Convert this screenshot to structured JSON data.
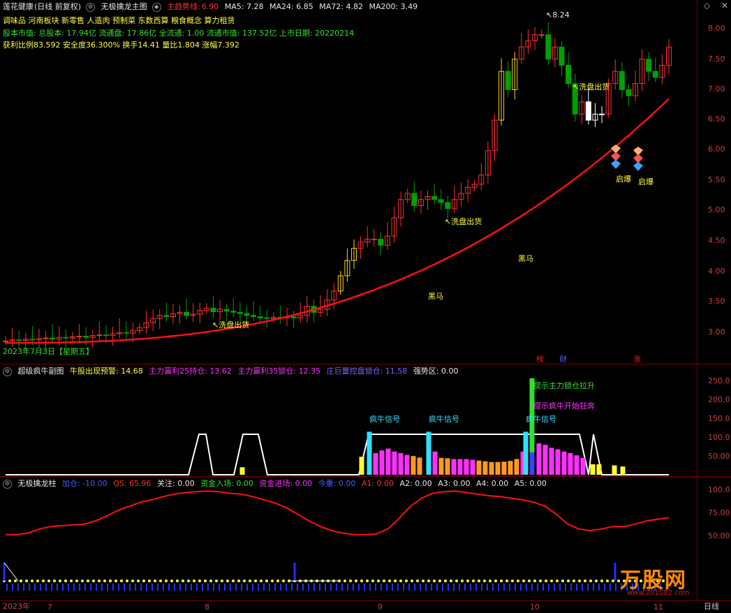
{
  "main_panel": {
    "stock_name": "莲花健康",
    "period": "(日线 前复权)",
    "indicator_name": "无极擒龙主图",
    "trend_label": "主趋势线:",
    "trend_value": "6.90",
    "ma5": "MA5: 7.28",
    "ma24": "MA24: 6.85",
    "ma72": "MA72: 4.82",
    "ma200": "MA200: 3.49",
    "concepts": "调味品 河南板块 新零售 人造肉 预制菜 东数西算 粮食概念 算力租赁",
    "info_line": "股本市值: 总股本: 17.94亿 流通盘: 17.86亿 全流通: 1.00 流通市值: 137.52亿 上市日期: 20220214",
    "stats_line": "获利比例83.592 安全度36.300% 换手14.41 量比1.804 涨幅7.392",
    "date_label": "2023年7月3日【星期五】",
    "peak_label": "8.24",
    "annotations": [
      "洗盘出货",
      "洗盘出货",
      "洗盘出货",
      "黑马",
      "黑马",
      "启爆",
      "启爆"
    ],
    "tags": [
      "榜",
      "财",
      "涨"
    ],
    "y_ticks": [
      "8.00",
      "7.50",
      "7.00",
      "6.50",
      "6.00",
      "5.50",
      "5.00",
      "4.50",
      "4.00",
      "3.50",
      "3.00"
    ]
  },
  "sub_panel": {
    "name": "超级疯牛副图",
    "warn_label": "牛股出现预警: 14.68",
    "profit25": "主力赢利25持仓: 13.62",
    "profit35": "主力赢利35锁仓: 12.35",
    "control": "庄巨量控盘锁仓: 11.58",
    "strong": "强势区: 0.00",
    "signals": [
      "疯牛信号",
      "疯牛信号",
      "疯牛信号"
    ],
    "text1": "提示主力锁仓拉升",
    "text2": "提示疯牛开始狂奔",
    "y_ticks": [
      "250.0",
      "200.0",
      "150.0",
      "100.0",
      "50.00"
    ]
  },
  "bottom_panel": {
    "name": "无极擒龙柱",
    "add": "加仓: -10.00",
    "qs": "QS: 65.96",
    "focus": "关注: 0.00",
    "enter": "资金入场: 0.00",
    "inflow": "资金进场: 0.00",
    "today": "今重: 0.00",
    "a1": "A1: 0.00",
    "a2": "A2: 0.00",
    "a3": "A3: 0.00",
    "a4": "A4: 0.00",
    "a5": "A5: 0.00",
    "y_ticks": [
      "100.0",
      "75.00",
      "50.00"
    ]
  },
  "x_axis": {
    "year": "2023年",
    "months": [
      "7",
      "8",
      "9",
      "10",
      "11"
    ],
    "period_label": "日线"
  },
  "watermark": {
    "brand": "万股网",
    "url": "www.201082.com"
  },
  "colors": {
    "up": "#ff3030",
    "down": "#00a000",
    "trend": "#ff1010",
    "grid": "#7a0000",
    "magenta": "#ff30ff",
    "cyan": "#30e0ff",
    "yellow": "#ffff30"
  }
}
